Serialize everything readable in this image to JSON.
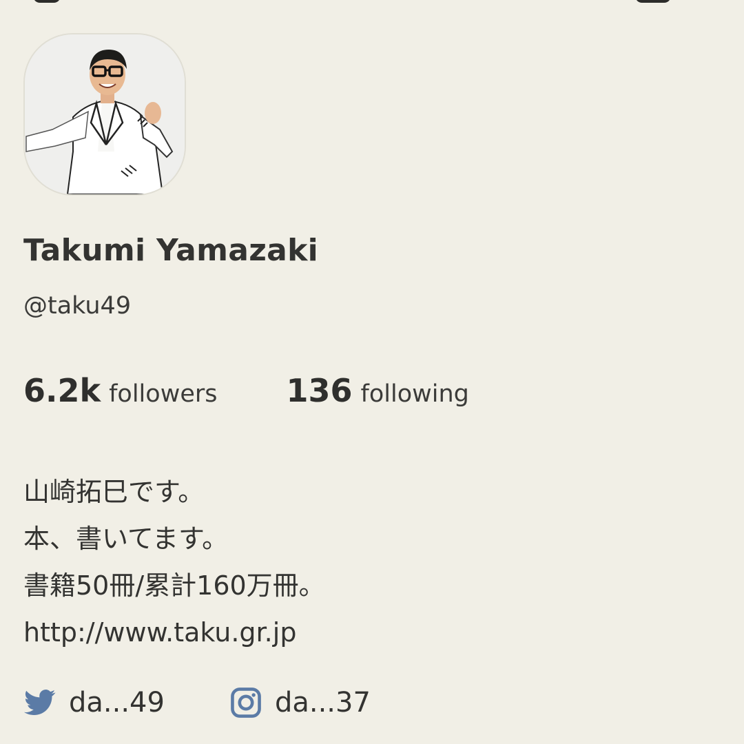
{
  "profile": {
    "name": "Takumi Yamazaki",
    "handle": "@taku49"
  },
  "stats": {
    "followers_count": "6.2k",
    "followers_label": "followers",
    "following_count": "136",
    "following_label": "following"
  },
  "bio": {
    "lines": [
      "山崎拓巳です。",
      "本、書いてます。",
      "書籍50冊/累計160万冊。",
      "http://www.taku.gr.jp"
    ]
  },
  "socials": {
    "twitter": {
      "icon": "twitter-bird-icon",
      "label": "da...49"
    },
    "instagram": {
      "icon": "instagram-icon",
      "label": "da...37"
    }
  },
  "colors": {
    "background": "#f1efe6",
    "text": "#333331",
    "social_icon": "#5b7ba6"
  }
}
